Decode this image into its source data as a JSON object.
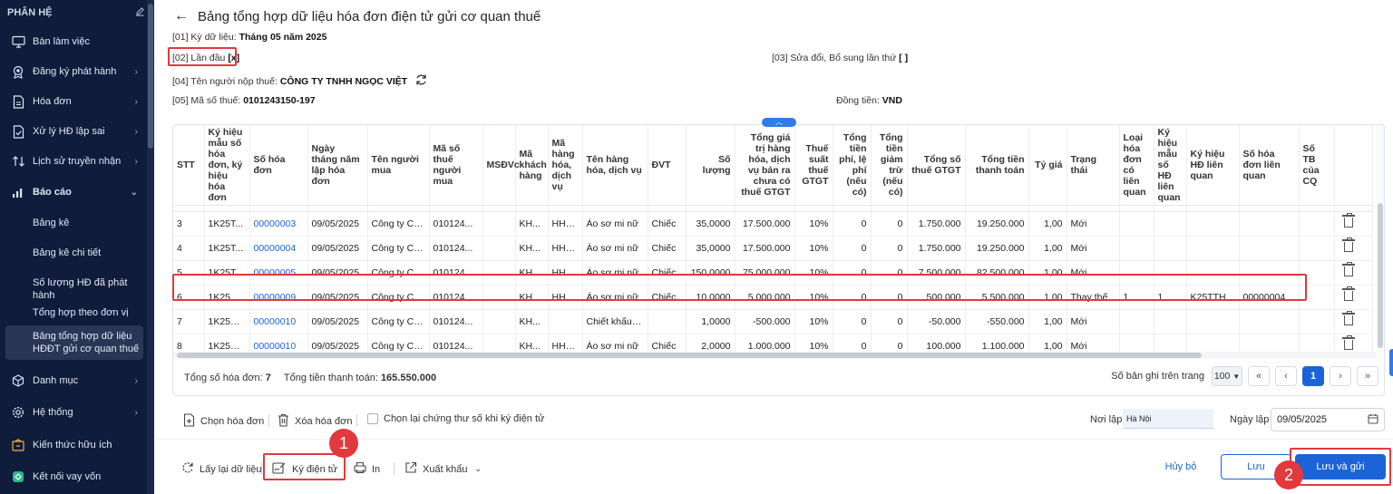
{
  "sidebar": {
    "header": "PHÂN HỆ",
    "items": [
      {
        "label": "Bàn làm việc",
        "icon": "monitor-icon",
        "chevron": false
      },
      {
        "label": "Đăng ký phát hành",
        "icon": "badge-icon",
        "chevron": true
      },
      {
        "label": "Hóa đơn",
        "icon": "document-icon",
        "chevron": true
      },
      {
        "label": "Xử lý HĐ lập sai",
        "icon": "document-check-icon",
        "chevron": true
      },
      {
        "label": "Lịch sử truyền nhận",
        "icon": "transfer-icon",
        "chevron": true
      },
      {
        "label": "Báo cáo",
        "icon": "bar-chart-icon",
        "chevron": "down"
      }
    ],
    "sub_items": [
      "Bảng kê",
      "Bảng kê chi tiết",
      "Số lượng HĐ đã phát hành",
      "Tổng hợp theo đơn vị",
      "Bảng tổng hợp dữ liệu HĐĐT gửi cơ quan thuế"
    ],
    "bottom_items": [
      {
        "label": "Danh mục",
        "icon": "cube-icon",
        "chevron": true
      },
      {
        "label": "Hệ thống",
        "icon": "gear-icon",
        "chevron": true
      },
      {
        "label": "Kiến thức hữu ích",
        "icon": "lightbulb-icon",
        "chevron": false
      },
      {
        "label": "Kết nối vay vốn",
        "icon": "loan-icon",
        "chevron": false
      }
    ]
  },
  "page": {
    "title": "Bảng tổng hợp dữ liệu hóa đơn điện tử gửi cơ quan thuế",
    "period_label": "[01] Kỳ dữ liệu:",
    "period_value": "Tháng 05 năm 2025",
    "first_label": "[02] Lần đầu",
    "first_value": "[x]",
    "amend_label": "[03] Sửa đổi, Bổ sung lần thứ",
    "amend_value": "[ ]",
    "taxpayer_label": "[04] Tên người nộp thuế:",
    "taxpayer_value": "CÔNG TY TNHH NGỌC VIỆT",
    "taxcode_label": "[05] Mã số thuế:",
    "taxcode_value": "0101243150-197",
    "currency_label": "Đồng tiền:",
    "currency_value": "VND"
  },
  "table": {
    "columns": [
      "STT",
      "Ký hiệu mẫu số hóa đơn, ký hiệu hóa đơn",
      "Số hóa đơn",
      "Ngày tháng năm lập hóa đơn",
      "Tên người mua",
      "Mã số thuế người mua",
      "MSĐVc",
      "Mã khách hàng",
      "Mã hàng hóa, dịch vụ",
      "Tên hàng hóa, dịch vụ",
      "ĐVT",
      "Số lượng",
      "Tổng giá trị hàng hóa, dịch vụ bán ra chưa có thuế GTGT",
      "Thuế suất thuế GTGT",
      "Tổng tiền phí, lệ phí (nếu có)",
      "Tổng tiền giảm trừ (nếu có)",
      "Tổng số thuế GTGT",
      "Tổng tiền thanh toán",
      "Tỷ giá",
      "Trạng thái",
      "Loại hóa đơn có liên quan",
      "Ký hiệu mẫu số HĐ liên quan",
      "Ký hiệu HĐ liên quan",
      "Số hóa đơn liên quan",
      "Số TB của CQ",
      ""
    ],
    "rows": [
      [
        "3",
        "1K25T...",
        "00000003",
        "09/05/2025",
        "Công ty CP ...",
        "010124...",
        "",
        "KH...",
        "HH0...",
        "Áo sơ mi nữ",
        "Chiếc",
        "35,0000",
        "17.500.000",
        "10%",
        "0",
        "0",
        "1.750.000",
        "19.250.000",
        "1,00",
        "Mới",
        "",
        "",
        "",
        "",
        ""
      ],
      [
        "4",
        "1K25T...",
        "00000004",
        "09/05/2025",
        "Công ty CP ...",
        "010124...",
        "",
        "KH...",
        "HH0...",
        "Áo sơ mi nữ",
        "Chiếc",
        "35,0000",
        "17.500.000",
        "10%",
        "0",
        "0",
        "1.750.000",
        "19.250.000",
        "1,00",
        "Mới",
        "",
        "",
        "",
        "",
        ""
      ],
      [
        "5",
        "1K25T...",
        "00000005",
        "09/05/2025",
        "Công ty CP ...",
        "010124...",
        "",
        "KH...",
        "HH0...",
        "Áo sơ mi nữ",
        "Chiếc",
        "150,0000",
        "75.000.000",
        "10%",
        "0",
        "0",
        "7.500.000",
        "82.500.000",
        "1,00",
        "Mới",
        "",
        "",
        "",
        "",
        ""
      ],
      [
        "6",
        "1K25TTH",
        "00000009",
        "09/05/2025",
        "Công ty CP ...",
        "010124...",
        "",
        "KH...",
        "HH0...",
        "Áo sơ mi nữ",
        "Chiếc",
        "10,0000",
        "5.000.000",
        "10%",
        "0",
        "0",
        "500.000",
        "5.500.000",
        "1,00",
        "Thay thế",
        "1",
        "1",
        "K25TTH",
        "00000004",
        ""
      ],
      [
        "7",
        "1K25TTH",
        "00000010",
        "09/05/2025",
        "Công ty CP ...",
        "010124...",
        "",
        "KH...",
        "",
        "Chiết khấu th...",
        "",
        "1,0000",
        "-500.000",
        "10%",
        "0",
        "0",
        "-50.000",
        "-550.000",
        "1,00",
        "Mới",
        "",
        "",
        "",
        "",
        ""
      ],
      [
        "8",
        "1K25TTH",
        "00000010",
        "09/05/2025",
        "Công ty CP ...",
        "010124...",
        "",
        "KH...",
        "HH0...",
        "Áo sơ mi nữ",
        "Chiếc",
        "2,0000",
        "1.000.000",
        "10%",
        "0",
        "0",
        "100.000",
        "1.100.000",
        "1,00",
        "Mới",
        "",
        "",
        "",
        "",
        ""
      ]
    ],
    "total_invoices_label": "Tổng số hóa đơn:",
    "total_invoices_value": "7",
    "total_amount_label": "Tổng tiền thanh toán:",
    "total_amount_value": "165.550.000",
    "page_size_label": "Số bản ghi trên trang",
    "page_size_value": "100",
    "current_page": "1"
  },
  "toolbar": {
    "choose_invoice": "Chọn hóa đơn",
    "delete_invoice": "Xóa hóa đơn",
    "reselect_cert": "Chọn lại chứng thư số khi ký điện tử",
    "place_label": "Nơi lập",
    "place_value": "Hà Nội",
    "date_label": "Ngày lập",
    "date_value": "09/05/2025"
  },
  "actions": {
    "reload": "Lấy lại dữ liệu",
    "sign": "Ký điện tử",
    "print": "In",
    "export": "Xuất khẩu",
    "cancel": "Hủy bỏ",
    "save": "Lưu",
    "save_send": "Lưu và gửi",
    "step1": "1",
    "step2": "2"
  },
  "colors": {
    "primary": "#1a64d8",
    "sidebar": "#101c3c",
    "highlight": "#e0393e"
  }
}
